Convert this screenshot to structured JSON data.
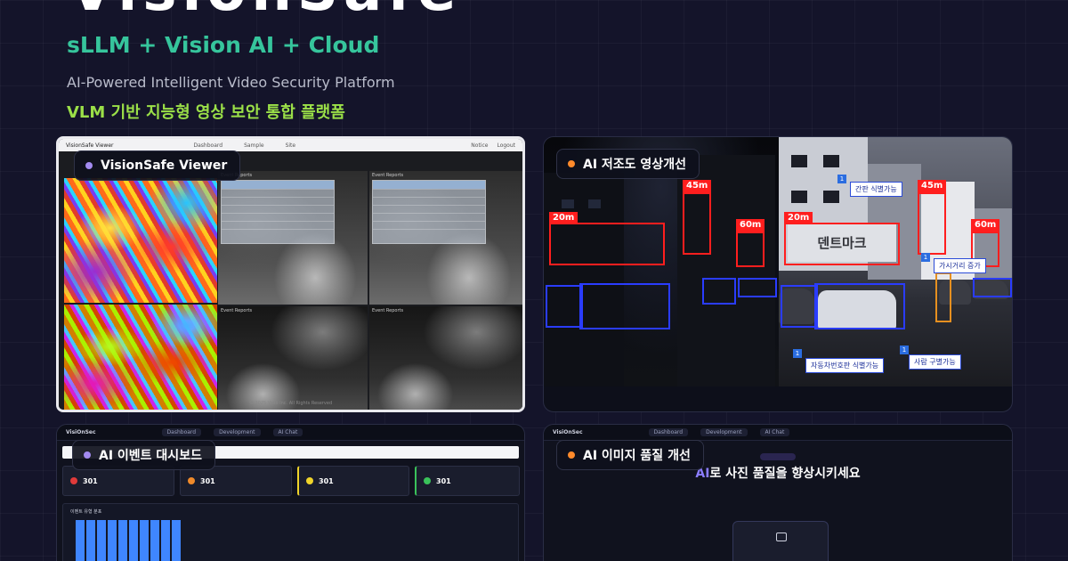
{
  "header": {
    "brand_cut": "VisionSafe",
    "tagline_main": "sLLM + Vision AI + Cloud",
    "tagline_en": "AI-Powered Intelligent Video Security Platform",
    "tagline_ko": "VLM 기반 지능형 영상 보안 통합 플랫폼"
  },
  "colors": {
    "background": "#14142a",
    "accent_teal": "#36c59c",
    "accent_lime": "#9be048",
    "tag_dot_purple": "#a38bf0",
    "tag_dot_orange": "#ff8a2b"
  },
  "cards": [
    {
      "tag": "VisionSafe Viewer",
      "dot": "purple",
      "app_title": "VisionSafe Viewer",
      "nav": [
        "Dashboard",
        "Sample",
        "Site"
      ],
      "nav_right": [
        "Notice",
        "Logout"
      ],
      "panel_titles": [
        "Event Reports",
        "Event Reports",
        "Event Reports",
        "Event Reports"
      ],
      "footer": "© 2025 Visio Inc. All Rights Reserved"
    },
    {
      "tag": "AI 저조도 영상개선",
      "dot": "orange",
      "distances_left": [
        "20m",
        "45m",
        "60m"
      ],
      "distances_right": [
        "20m",
        "45m",
        "60m"
      ],
      "signboard_text": "덴트마크",
      "notes": [
        "간판 식별가능",
        "가시거리 증가",
        "자동차번호판 식별가능",
        "사람 구별가능"
      ],
      "note_numbers": [
        "1",
        "1",
        "1",
        "1"
      ]
    },
    {
      "tag": "AI 이벤트 대시보드",
      "dot": "purple",
      "app_title": "VisiOnSec",
      "nav": [
        "Dashboard",
        "Development",
        "AI Chat"
      ],
      "stats": [
        {
          "value": "301",
          "color": "#e03a3a"
        },
        {
          "value": "301",
          "color": "#f08a2a"
        },
        {
          "value": "301",
          "color": "#f0d42a"
        },
        {
          "value": "301",
          "color": "#3ac25a"
        }
      ],
      "chart_title": "이벤트 유형 분포",
      "bar_count": 10
    },
    {
      "tag": "AI 이미지 품질 개선",
      "dot": "orange",
      "app_title": "VisiOnSec",
      "nav": [
        "Dashboard",
        "Development",
        "AI Chat"
      ],
      "headline_ai": "AI",
      "headline_rest": "로 사진 품질을 향상시키세요"
    }
  ]
}
